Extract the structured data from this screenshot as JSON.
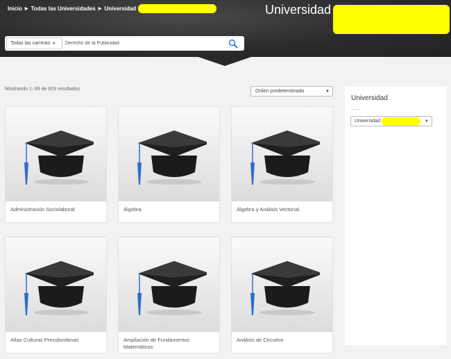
{
  "header": {
    "breadcrumb": [
      "Inicio",
      "Todas las Universidades",
      "Universidad"
    ],
    "title": "Universidad"
  },
  "search": {
    "category_label": "Todas las carreras",
    "query": "Derecho de la Publicidad"
  },
  "results": {
    "count_text": "Mostrando 1–99 de 923 resultados",
    "sort_label": "Orden predeterminado"
  },
  "products": [
    {
      "name": "Administración Sociolaboral"
    },
    {
      "name": "Álgebra"
    },
    {
      "name": "Álgebra y Análisis Vectorial"
    },
    {
      "name": "Altas Culturas Precolombinas"
    },
    {
      "name": "Ampliación de Fundamentos Matemáticos"
    },
    {
      "name": "Análisis de Circuitos"
    }
  ],
  "sidebar": {
    "title": "Universidad",
    "select_value": "Universidad"
  },
  "colors": {
    "header_bg": "#2c2c2c",
    "redaction": "#ffff00",
    "search_icon": "#2a7fd4"
  }
}
